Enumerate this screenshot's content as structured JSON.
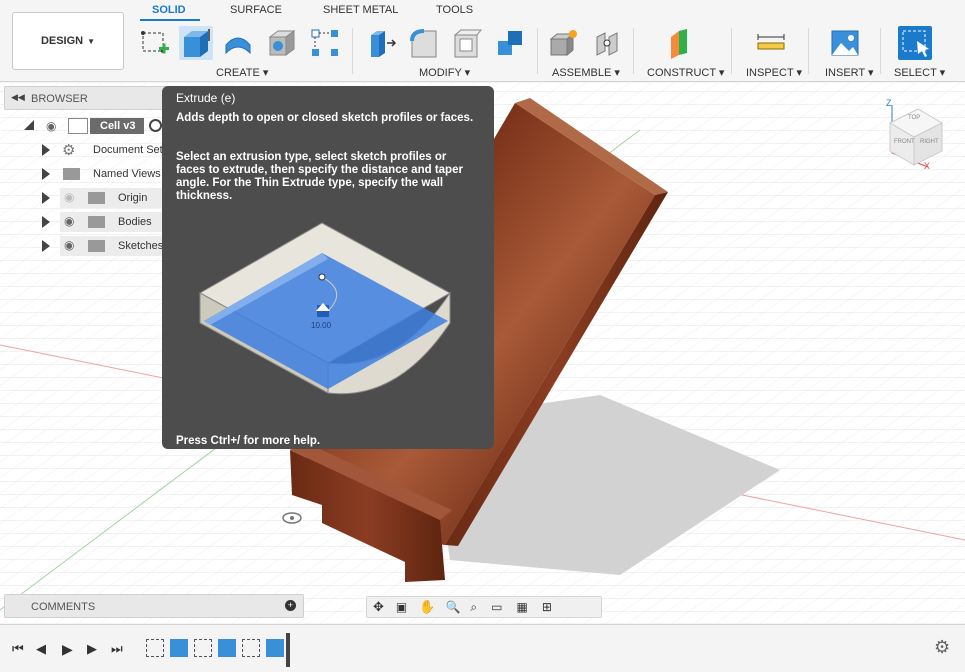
{
  "toolbar": {
    "workspace_label": "DESIGN",
    "tabs": [
      {
        "label": "SOLID",
        "active": true
      },
      {
        "label": "SURFACE",
        "active": false
      },
      {
        "label": "SHEET METAL",
        "active": false
      },
      {
        "label": "TOOLS",
        "active": false
      }
    ],
    "groups": {
      "create": "CREATE",
      "modify": "MODIFY",
      "assemble": "ASSEMBLE",
      "construct": "CONSTRUCT",
      "inspect": "INSPECT",
      "insert": "INSERT",
      "select": "SELECT"
    }
  },
  "browser": {
    "title": "BROWSER",
    "root": "Cell v3",
    "items": [
      {
        "label": "Document Setti"
      },
      {
        "label": "Named Views"
      },
      {
        "label": "Origin"
      },
      {
        "label": "Bodies"
      },
      {
        "label": "Sketches"
      }
    ]
  },
  "tooltip": {
    "title": "Extrude (e)",
    "description": "Adds depth to open or closed sketch profiles or faces.",
    "detail": "Select an extrusion type, select sketch profiles or faces to extrude, then specify the distance and taper angle. For the Thin Extrude type, specify the wall thickness.",
    "illustration_value": "10.00",
    "help": "Press Ctrl+/ for more help."
  },
  "viewcube": {
    "top": "TOP",
    "front": "FRONT",
    "right": "RIGHT",
    "axis_z": "Z",
    "axis_x": "X"
  },
  "comments": {
    "title": "COMMENTS"
  },
  "colors": {
    "accent": "#1a7acb",
    "wood": "#8a3a22",
    "tooltip_bg": "#4d4d4d"
  }
}
